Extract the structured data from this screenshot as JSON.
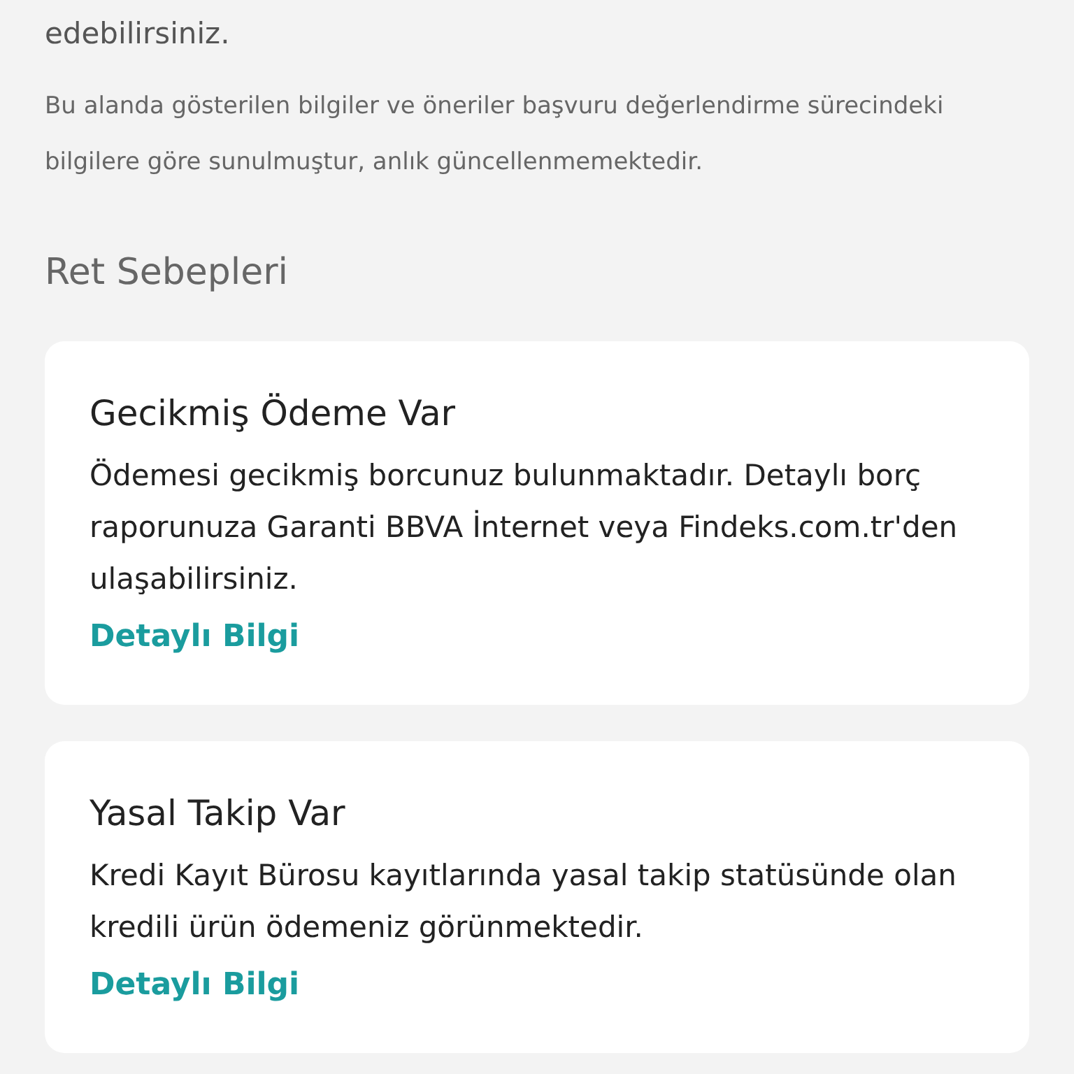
{
  "intro_tail": "edebilirsiniz.",
  "notice": "Bu alanda gösterilen bilgiler ve öneriler başvuru değerlendirme sürecindeki bilgilere göre sunulmuştur, anlık güncellenmemektedir.",
  "section_title": "Ret Sebepleri",
  "reasons": [
    {
      "title": "Gecikmiş Ödeme Var",
      "description": "Ödemesi gecikmiş borcunuz bulunmaktadır. Detaylı borç raporunuza Garanti BBVA İnternet veya Findeks.com.tr'den ulaşabilirsiniz.",
      "link": "Detaylı Bilgi"
    },
    {
      "title": "Yasal Takip Var",
      "description": "Kredi Kayıt Bürosu kayıtlarında yasal takip statüsünde olan kredili ürün ödemeniz görünmektedir.",
      "link": "Detaylı Bilgi"
    }
  ]
}
